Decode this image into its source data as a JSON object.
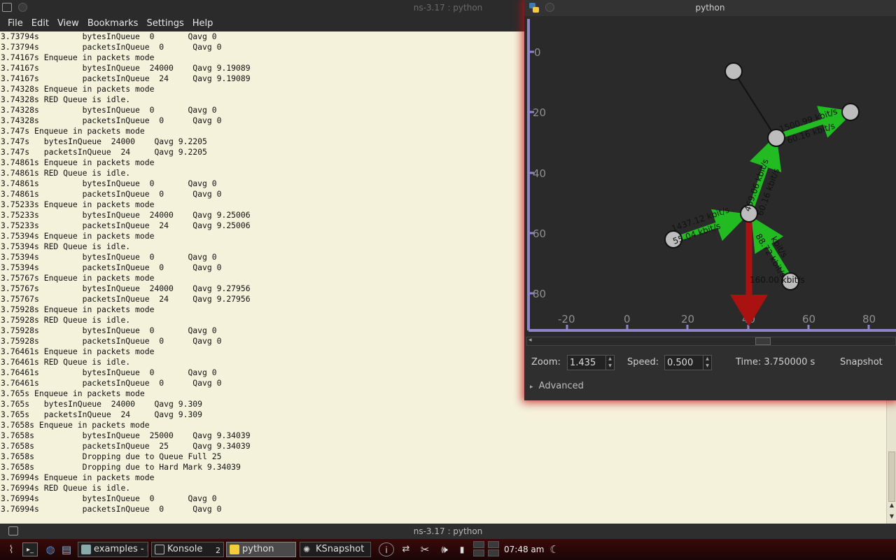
{
  "konsole": {
    "window_title": "ns-3.17 : python",
    "status_title": "ns-3.17 : python",
    "menu": [
      "File",
      "Edit",
      "View",
      "Bookmarks",
      "Settings",
      "Help"
    ],
    "lines": [
      "3.73794s         bytesInQueue  0       Qavg 0",
      "3.73794s         packetsInQueue  0      Qavg 0",
      "3.74167s Enqueue in packets mode",
      "3.74167s         bytesInQueue  24000    Qavg 9.19089",
      "3.74167s         packetsInQueue  24     Qavg 9.19089",
      "3.74328s Enqueue in packets mode",
      "3.74328s RED Queue is idle.",
      "3.74328s         bytesInQueue  0       Qavg 0",
      "3.74328s         packetsInQueue  0      Qavg 0",
      "3.747s Enqueue in packets mode",
      "3.747s   bytesInQueue  24000    Qavg 9.2205",
      "3.747s   packetsInQueue  24     Qavg 9.2205",
      "3.74861s Enqueue in packets mode",
      "3.74861s RED Queue is idle.",
      "3.74861s         bytesInQueue  0       Qavg 0",
      "3.74861s         packetsInQueue  0      Qavg 0",
      "3.75233s Enqueue in packets mode",
      "3.75233s         bytesInQueue  24000    Qavg 9.25006",
      "3.75233s         packetsInQueue  24     Qavg 9.25006",
      "3.75394s Enqueue in packets mode",
      "3.75394s RED Queue is idle.",
      "3.75394s         bytesInQueue  0       Qavg 0",
      "3.75394s         packetsInQueue  0      Qavg 0",
      "3.75767s Enqueue in packets mode",
      "3.75767s         bytesInQueue  24000    Qavg 9.27956",
      "3.75767s         packetsInQueue  24     Qavg 9.27956",
      "3.75928s Enqueue in packets mode",
      "3.75928s RED Queue is idle.",
      "3.75928s         bytesInQueue  0       Qavg 0",
      "3.75928s         packetsInQueue  0      Qavg 0",
      "3.76461s Enqueue in packets mode",
      "3.76461s RED Queue is idle.",
      "3.76461s         bytesInQueue  0       Qavg 0",
      "3.76461s         packetsInQueue  0      Qavg 0",
      "3.765s Enqueue in packets mode",
      "3.765s   bytesInQueue  24000    Qavg 9.309",
      "3.765s   packetsInQueue  24     Qavg 9.309",
      "3.7658s Enqueue in packets mode",
      "3.7658s          bytesInQueue  25000    Qavg 9.34039",
      "3.7658s          packetsInQueue  25     Qavg 9.34039",
      "3.7658s          Dropping due to Queue Full 25",
      "3.7658s          Dropping due to Hard Mark 9.34039",
      "3.76994s Enqueue in packets mode",
      "3.76994s RED Queue is idle.",
      "3.76994s         bytesInQueue  0       Qavg 0",
      "3.76994s         packetsInQueue  0      Qavg 0"
    ]
  },
  "python_window": {
    "title": "python",
    "topology": {
      "y_ticks": [
        "0",
        "20",
        "40",
        "60",
        "80"
      ],
      "x_ticks": [
        "-20",
        "0",
        "20",
        "40",
        "60",
        "80"
      ],
      "link_labels": {
        "top_right_a": "1500.99 kbit/s",
        "top_right_b": "60.16 kbit/s",
        "mid_a": "469.06 kbit/s",
        "mid_b": "60.16 kbit/s",
        "left_a": "1437.12 kbit/s",
        "left_b": "55.04 kbit/s",
        "bottom_a": "88.72 kbit/s",
        "bottom_b": "kbit/s",
        "drop": "160.00 kbit/s"
      },
      "colors": {
        "flow": "#22bb22",
        "drop": "#aa1111",
        "node": "#bdbdbd",
        "axis": "#8f86c9"
      }
    },
    "zoom_label": "Zoom:",
    "zoom_value": "1.435",
    "speed_label": "Speed:",
    "speed_value": "0.500",
    "time_label": "Time: 3.750000 s",
    "snapshot_label": "Snapshot",
    "advanced_label": "Advanced"
  },
  "taskbar": {
    "tasks": [
      {
        "label": "examples - D"
      },
      {
        "label": "Konsole"
      },
      {
        "label": "python"
      },
      {
        "label": "KSnapshot"
      }
    ],
    "konsole_count": "2",
    "clock": "07:48 am"
  }
}
